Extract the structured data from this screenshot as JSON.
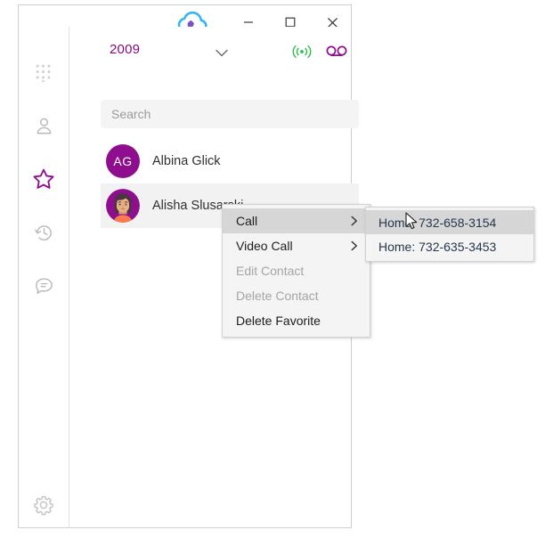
{
  "window": {
    "logo_icon": "cloud-phone-logo",
    "controls": {
      "minimize_label": "─",
      "maximize_label": "□",
      "close_label": "✕"
    }
  },
  "nav_rail": {
    "items": [
      {
        "id": "dialpad",
        "icon": "dialpad-icon",
        "active": false
      },
      {
        "id": "contacts",
        "icon": "person-icon",
        "active": false
      },
      {
        "id": "favorites",
        "icon": "star-icon",
        "active": true
      },
      {
        "id": "history",
        "icon": "history-icon",
        "active": false
      },
      {
        "id": "messages",
        "icon": "chat-bubble-icon",
        "active": false
      },
      {
        "id": "settings",
        "icon": "gear-icon",
        "active": false
      }
    ]
  },
  "account_bar": {
    "extension": "2009",
    "chevron_icon": "chevron-down-icon",
    "presence_icon": "presence-broadcast-icon",
    "voicemail_icon": "voicemail-icon"
  },
  "search": {
    "placeholder": "Search",
    "value": ""
  },
  "contacts": [
    {
      "name": "Albina Glick",
      "avatar_type": "initials",
      "initials": "AG",
      "selected": false
    },
    {
      "name": "Alisha Slusarski",
      "avatar_type": "photo",
      "initials": "",
      "selected": true
    }
  ],
  "context_menu": {
    "items": [
      {
        "label": "Call",
        "has_submenu": true,
        "disabled": false,
        "highlighted": true
      },
      {
        "label": "Video Call",
        "has_submenu": true,
        "disabled": false,
        "highlighted": false
      },
      {
        "label": "Edit Contact",
        "has_submenu": false,
        "disabled": true,
        "highlighted": false
      },
      {
        "label": "Delete Contact",
        "has_submenu": false,
        "disabled": true,
        "highlighted": false
      },
      {
        "label": "Delete Favorite",
        "has_submenu": false,
        "disabled": false,
        "highlighted": false
      }
    ]
  },
  "call_submenu": {
    "items": [
      {
        "label": "Home: 732-658-3154",
        "highlighted": true
      },
      {
        "label": "Home: 732-635-3453",
        "highlighted": false
      }
    ]
  },
  "colors": {
    "brand_purple": "#8e0e8e",
    "accent_purple": "#7d0a7d",
    "presence_green": "#2bbf4e",
    "logo_cloud_blue": "#35b6ef",
    "menu_background": "#f4f4f4",
    "menu_highlight": "#d6d6d6",
    "row_highlight": "#f2f2f2",
    "submenu_text": "#27374d"
  }
}
